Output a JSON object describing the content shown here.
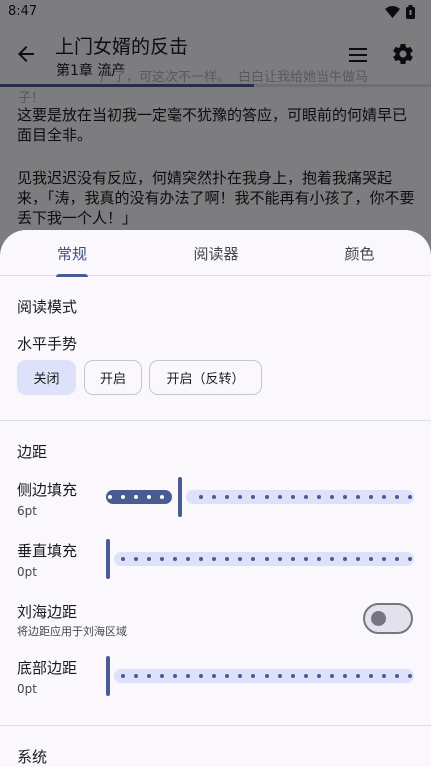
{
  "status_bar": {
    "time": "8:47"
  },
  "reader": {
    "book_title": "上门女婿的反击",
    "chapter_title": "第1章 流产",
    "progress_fraction": 0.59,
    "ghost_lines": [
      "产了，可这次不一样。",
      "白白让我给她当牛做马",
      "子！"
    ],
    "paragraph_1": "这要是放在当初我一定毫不犹豫的答应，可眼前的何婧早已面目全非。",
    "paragraph_2": "见我迟迟没有反应，何婧突然扑在我身上，抱着我痛哭起来，「涛，我真的没有办法了啊！我不能再有小孩了，你不要丢下我一个人！」"
  },
  "sheet": {
    "tabs": [
      {
        "label": "常规",
        "active": true
      },
      {
        "label": "阅读器",
        "active": false
      },
      {
        "label": "颜色",
        "active": false
      }
    ],
    "reading_mode": {
      "title": "阅读模式",
      "horizontal_gesture_label": "水平手势",
      "options": [
        "关闭",
        "开启",
        "开启（反转）"
      ],
      "selected_index": 0
    },
    "margins": {
      "title": "边距",
      "side_padding": {
        "label": "侧边填充",
        "value": "6pt",
        "level": 0.24
      },
      "vertical_padding": {
        "label": "垂直填充",
        "value": "0pt",
        "level": 0
      },
      "notch_margin": {
        "label": "刘海边距",
        "description": "将边距应用于刘海区域",
        "enabled": false
      },
      "bottom_margin": {
        "label": "底部边距",
        "value": "0pt",
        "level": 0
      }
    },
    "system": {
      "title": "系统"
    }
  },
  "colors": {
    "accent": "#4a5a93",
    "chip_selected": "#dde1f9",
    "track": "#dde1f9"
  }
}
